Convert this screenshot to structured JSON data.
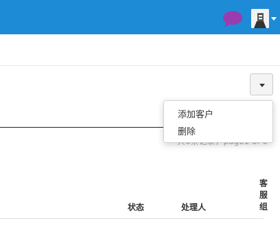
{
  "colors": {
    "topbar": "#1e8bd6",
    "chat_icon": "#9a3cae"
  },
  "header": {
    "icons": [
      "chat-bubble-icon",
      "user-avatar",
      "chevron-down-icon"
    ]
  },
  "toolbar": {
    "dropdown_toggle_icon": "caret-down-icon"
  },
  "dropdown_menu": {
    "items": [
      {
        "label": "添加客户"
      },
      {
        "label": "删除"
      }
    ]
  },
  "records": {
    "info": "共0条记录，page1 of 0"
  },
  "table": {
    "columns": [
      "状态",
      "处理人",
      "客服组"
    ]
  }
}
